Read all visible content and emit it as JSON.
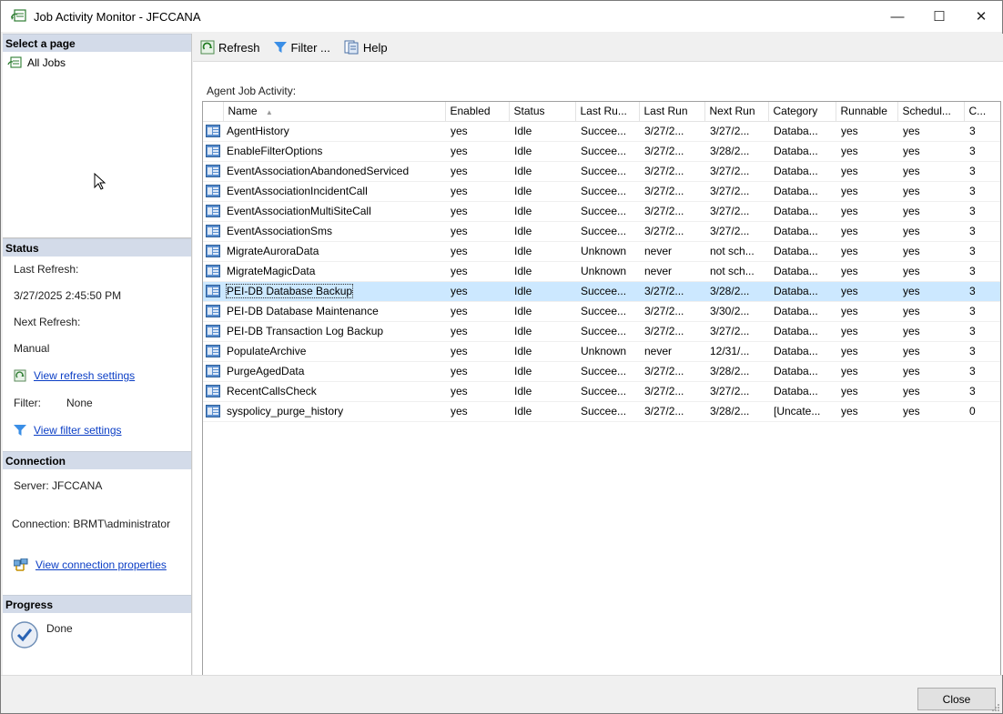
{
  "window": {
    "title": "Job Activity Monitor - JFCCANA",
    "minimize": "—",
    "maximize": "☐",
    "close": "✕"
  },
  "left": {
    "select_page_header": "Select a page",
    "pages": [
      {
        "label": "All Jobs"
      }
    ],
    "status_header": "Status",
    "last_refresh_label": "Last Refresh:",
    "last_refresh_value": "3/27/2025 2:45:50 PM",
    "next_refresh_label": "Next Refresh:",
    "next_refresh_value": "Manual",
    "view_refresh_link": "View refresh settings",
    "filter_label": "Filter:",
    "filter_value": "None",
    "view_filter_link": "View filter settings",
    "connection_header": "Connection",
    "server_text": "Server: JFCCANA",
    "connection_text": "Connection: BRMT\\administrator",
    "view_connection_link": "View connection properties",
    "progress_header": "Progress",
    "progress_text": "Done"
  },
  "toolbar": {
    "refresh": "Refresh",
    "filter": "Filter ...",
    "help": "Help"
  },
  "grid": {
    "caption": "Agent Job Activity:",
    "sort_indicator": "▲",
    "columns": [
      "Name",
      "Enabled",
      "Status",
      "Last Ru...",
      "Last Run",
      "Next Run",
      "Category",
      "Runnable",
      "Schedul...",
      "C..."
    ],
    "rows": [
      {
        "name": "AgentHistory",
        "enabled": "yes",
        "status": "Idle",
        "last_outcome": "Succee...",
        "last_run": "3/27/2...",
        "next_run": "3/27/2...",
        "category": "Databa...",
        "runnable": "yes",
        "scheduled": "yes",
        "c": "3"
      },
      {
        "name": "EnableFilterOptions",
        "enabled": "yes",
        "status": "Idle",
        "last_outcome": "Succee...",
        "last_run": "3/27/2...",
        "next_run": "3/28/2...",
        "category": "Databa...",
        "runnable": "yes",
        "scheduled": "yes",
        "c": "3"
      },
      {
        "name": "EventAssociationAbandonedServiced",
        "enabled": "yes",
        "status": "Idle",
        "last_outcome": "Succee...",
        "last_run": "3/27/2...",
        "next_run": "3/27/2...",
        "category": "Databa...",
        "runnable": "yes",
        "scheduled": "yes",
        "c": "3"
      },
      {
        "name": "EventAssociationIncidentCall",
        "enabled": "yes",
        "status": "Idle",
        "last_outcome": "Succee...",
        "last_run": "3/27/2...",
        "next_run": "3/27/2...",
        "category": "Databa...",
        "runnable": "yes",
        "scheduled": "yes",
        "c": "3"
      },
      {
        "name": "EventAssociationMultiSiteCall",
        "enabled": "yes",
        "status": "Idle",
        "last_outcome": "Succee...",
        "last_run": "3/27/2...",
        "next_run": "3/27/2...",
        "category": "Databa...",
        "runnable": "yes",
        "scheduled": "yes",
        "c": "3"
      },
      {
        "name": "EventAssociationSms",
        "enabled": "yes",
        "status": "Idle",
        "last_outcome": "Succee...",
        "last_run": "3/27/2...",
        "next_run": "3/27/2...",
        "category": "Databa...",
        "runnable": "yes",
        "scheduled": "yes",
        "c": "3"
      },
      {
        "name": "MigrateAuroraData",
        "enabled": "yes",
        "status": "Idle",
        "last_outcome": "Unknown",
        "last_run": "never",
        "next_run": "not sch...",
        "category": "Databa...",
        "runnable": "yes",
        "scheduled": "yes",
        "c": "3"
      },
      {
        "name": "MigrateMagicData",
        "enabled": "yes",
        "status": "Idle",
        "last_outcome": "Unknown",
        "last_run": "never",
        "next_run": "not sch...",
        "category": "Databa...",
        "runnable": "yes",
        "scheduled": "yes",
        "c": "3"
      },
      {
        "name": "PEI-DB Database Backup",
        "enabled": "yes",
        "status": "Idle",
        "last_outcome": "Succee...",
        "last_run": "3/27/2...",
        "next_run": "3/28/2...",
        "category": "Databa...",
        "runnable": "yes",
        "scheduled": "yes",
        "c": "3",
        "selected": true
      },
      {
        "name": "PEI-DB Database Maintenance",
        "enabled": "yes",
        "status": "Idle",
        "last_outcome": "Succee...",
        "last_run": "3/27/2...",
        "next_run": "3/30/2...",
        "category": "Databa...",
        "runnable": "yes",
        "scheduled": "yes",
        "c": "3"
      },
      {
        "name": "PEI-DB Transaction Log Backup",
        "enabled": "yes",
        "status": "Idle",
        "last_outcome": "Succee...",
        "last_run": "3/27/2...",
        "next_run": "3/27/2...",
        "category": "Databa...",
        "runnable": "yes",
        "scheduled": "yes",
        "c": "3"
      },
      {
        "name": "PopulateArchive",
        "enabled": "yes",
        "status": "Idle",
        "last_outcome": "Unknown",
        "last_run": "never",
        "next_run": "12/31/...",
        "category": "Databa...",
        "runnable": "yes",
        "scheduled": "yes",
        "c": "3"
      },
      {
        "name": "PurgeAgedData",
        "enabled": "yes",
        "status": "Idle",
        "last_outcome": "Succee...",
        "last_run": "3/27/2...",
        "next_run": "3/28/2...",
        "category": "Databa...",
        "runnable": "yes",
        "scheduled": "yes",
        "c": "3"
      },
      {
        "name": "RecentCallsCheck",
        "enabled": "yes",
        "status": "Idle",
        "last_outcome": "Succee...",
        "last_run": "3/27/2...",
        "next_run": "3/27/2...",
        "category": "Databa...",
        "runnable": "yes",
        "scheduled": "yes",
        "c": "3"
      },
      {
        "name": "syspolicy_purge_history",
        "enabled": "yes",
        "status": "Idle",
        "last_outcome": "Succee...",
        "last_run": "3/27/2...",
        "next_run": "3/28/2...",
        "category": "[Uncate...",
        "runnable": "yes",
        "scheduled": "yes",
        "c": "0"
      }
    ]
  },
  "footer": {
    "close_label": "Close"
  },
  "colors": {
    "section_header_bg": "#d3dbe9",
    "selected_row_bg": "#cce8ff",
    "link": "#0b3ec5"
  }
}
